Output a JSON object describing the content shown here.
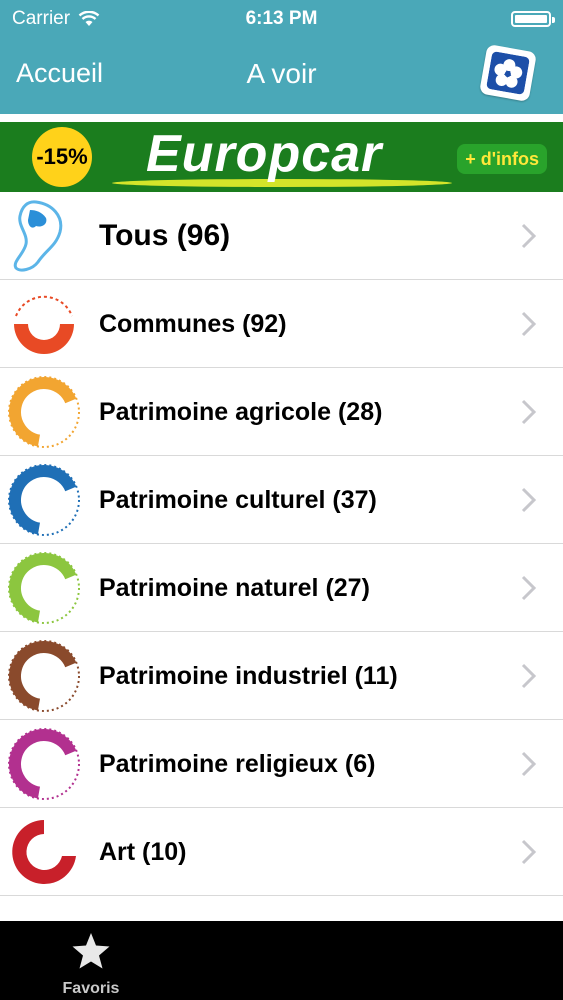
{
  "status_bar": {
    "carrier": "Carrier",
    "time": "6:13 PM"
  },
  "nav": {
    "back_label": "Accueil",
    "title": "A voir",
    "logo_icon": "hibiscus-logo-icon"
  },
  "banner": {
    "discount": "-15%",
    "brand": "Europcar",
    "more": "+ d'infos"
  },
  "list": [
    {
      "label": "Tous (96)",
      "icon": "guadeloupe-map-icon",
      "color": "#2b8fd8"
    },
    {
      "label": "Communes (92)",
      "icon": "communes-icon",
      "color": "#e84a25",
      "ring_text": "COMMUNES"
    },
    {
      "label": "Patrimoine agricole (28)",
      "icon": "patrimoine-agricole-icon",
      "color": "#f2a531",
      "ring_text": "PATRIMOINE",
      "sub_text": "AGRICOLE"
    },
    {
      "label": "Patrimoine culturel (37)",
      "icon": "patrimoine-culturel-icon",
      "color": "#1f6fb6",
      "ring_text": "PATRIMOINE",
      "sub_text": "CULTUREL"
    },
    {
      "label": "Patrimoine naturel (27)",
      "icon": "patrimoine-naturel-icon",
      "color": "#8cc63f",
      "ring_text": "PATRIMOINE",
      "sub_text": "NATUREL"
    },
    {
      "label": "Patrimoine industriel (11)",
      "icon": "patrimoine-industriel-icon",
      "color": "#8a4a2c",
      "ring_text": "PATRIMOINE",
      "sub_text": "INDUSTRIEL"
    },
    {
      "label": "Patrimoine religieux (6)",
      "icon": "patrimoine-religieux-icon",
      "color": "#b2308f",
      "ring_text": "PATRIMOINE",
      "sub_text": "RELIGIEUX"
    },
    {
      "label": "Art (10)",
      "icon": "art-icon",
      "color": "#c8202a",
      "ring_text": "ART"
    }
  ],
  "tabbar": {
    "favoris_label": "Favoris"
  },
  "colors": {
    "nav_bg": "#4aa8b8",
    "banner_bg": "#1b7d1e",
    "tabbar_bg": "#000000"
  }
}
